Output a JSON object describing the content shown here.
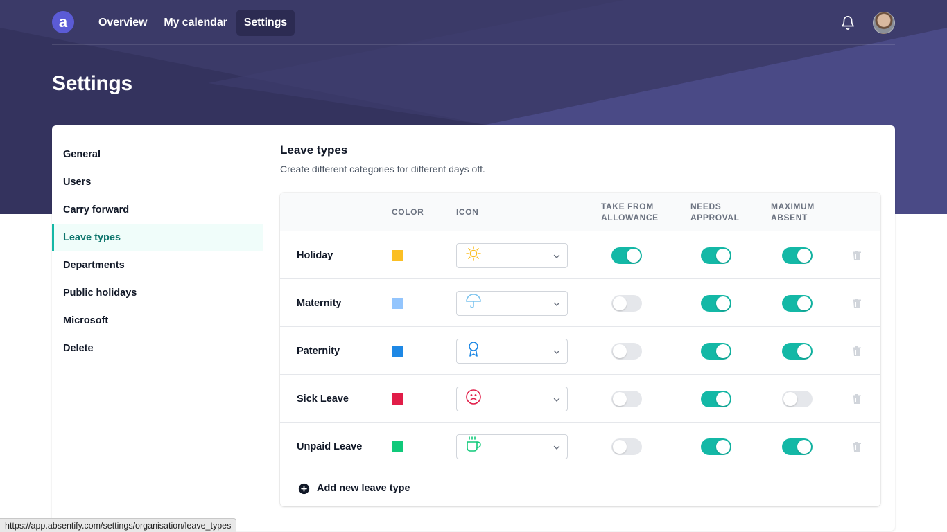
{
  "nav": {
    "logo": "a",
    "links": [
      {
        "label": "Overview",
        "active": false
      },
      {
        "label": "My calendar",
        "active": false
      },
      {
        "label": "Settings",
        "active": true
      }
    ]
  },
  "page": {
    "title": "Settings"
  },
  "sidebar": {
    "items": [
      {
        "label": "General"
      },
      {
        "label": "Users"
      },
      {
        "label": "Carry forward"
      },
      {
        "label": "Leave types",
        "active": true
      },
      {
        "label": "Departments"
      },
      {
        "label": "Public holidays"
      },
      {
        "label": "Microsoft"
      },
      {
        "label": "Delete"
      }
    ]
  },
  "section": {
    "title": "Leave types",
    "description": "Create different categories for different days off."
  },
  "table": {
    "headers": {
      "color": "COLOR",
      "icon": "ICON",
      "allowance_1": "TAKE FROM",
      "allowance_2": "ALLOWANCE",
      "approval_1": "NEEDS",
      "approval_2": "APPROVAL",
      "absent_1": "MAXIMUM",
      "absent_2": "ABSENT"
    },
    "rows": [
      {
        "name": "Holiday",
        "color": "#fbbf24",
        "icon": "sun-icon",
        "take_from_allowance": true,
        "needs_approval": true,
        "maximum_absent": true
      },
      {
        "name": "Maternity",
        "color": "#93c5fd",
        "icon": "umbrella-icon",
        "take_from_allowance": false,
        "needs_approval": true,
        "maximum_absent": true
      },
      {
        "name": "Paternity",
        "color": "#1e88e5",
        "icon": "award-icon",
        "take_from_allowance": false,
        "needs_approval": true,
        "maximum_absent": true
      },
      {
        "name": "Sick Leave",
        "color": "#e11d48",
        "icon": "sad-face-icon",
        "take_from_allowance": false,
        "needs_approval": true,
        "maximum_absent": false
      },
      {
        "name": "Unpaid Leave",
        "color": "#10c97a",
        "icon": "coffee-icon",
        "take_from_allowance": false,
        "needs_approval": true,
        "maximum_absent": true
      }
    ],
    "add_label": "Add new leave type"
  },
  "status_url": "https://app.absentify.com/settings/organisation/leave_types",
  "colors": {
    "accent": "#14b8a6",
    "header_bg": "#3b3a68"
  }
}
